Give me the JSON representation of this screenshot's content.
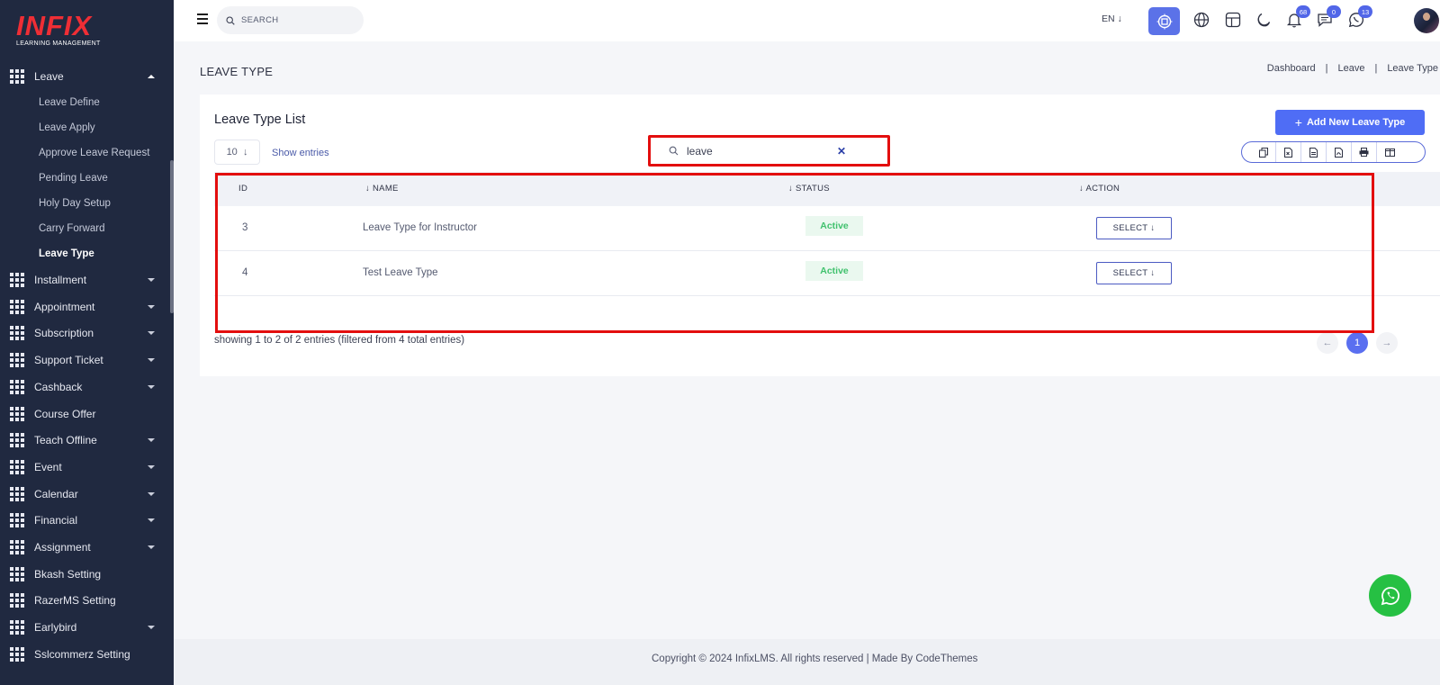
{
  "brand": {
    "name": "INFIX",
    "tagline": "LEARNING MANAGEMENT"
  },
  "sidebar": {
    "parent": {
      "label": "Leave",
      "icon": "grid-icon"
    },
    "subitems": [
      "Leave Define",
      "Leave Apply",
      "Approve Leave Request",
      "Pending Leave",
      "Holy Day Setup",
      "Carry Forward",
      "Leave Type"
    ],
    "active_subitem": "Leave Type",
    "items": [
      {
        "label": "Installment",
        "has_caret": true
      },
      {
        "label": "Appointment",
        "has_caret": true
      },
      {
        "label": "Subscription",
        "has_caret": true
      },
      {
        "label": "Support Ticket",
        "has_caret": true
      },
      {
        "label": "Cashback",
        "has_caret": true
      },
      {
        "label": "Course Offer",
        "has_caret": false
      },
      {
        "label": "Teach Offline",
        "has_caret": true
      },
      {
        "label": "Event",
        "has_caret": true
      },
      {
        "label": "Calendar",
        "has_caret": true
      },
      {
        "label": "Financial",
        "has_caret": true
      },
      {
        "label": "Assignment",
        "has_caret": true
      },
      {
        "label": "Bkash Setting",
        "has_caret": false
      },
      {
        "label": "RazerMS Setting",
        "has_caret": false
      },
      {
        "label": "Earlybird",
        "has_caret": true
      },
      {
        "label": "Sslcommerz Setting",
        "has_caret": false
      }
    ]
  },
  "header": {
    "search_placeholder": "SEARCH",
    "language": "EN",
    "badges": {
      "notifications": "68",
      "messages": "0",
      "whatsapp": "13"
    }
  },
  "page": {
    "title": "LEAVE TYPE",
    "breadcrumb": [
      "Dashboard",
      "Leave",
      "Leave Type"
    ]
  },
  "card": {
    "title": "Leave Type List",
    "add_button": "Add New Leave Type",
    "entries_value": "10",
    "show_entries": "Show entries",
    "search_value": "leave",
    "export_buttons": [
      "copy-icon",
      "excel-icon",
      "csv-icon",
      "pdf-icon",
      "print-icon",
      "columns-icon"
    ]
  },
  "table": {
    "headers": {
      "id": "ID",
      "name": "NAME",
      "status": "STATUS",
      "action": "ACTION"
    },
    "rows": [
      {
        "id": "3",
        "name": "Leave Type for Instructor",
        "status": "Active",
        "action": "SELECT"
      },
      {
        "id": "4",
        "name": "Test Leave Type",
        "status": "Active",
        "action": "SELECT"
      }
    ],
    "info": "showing 1 to 2 of 2 entries (filtered from 4 total entries)",
    "current_page": "1"
  },
  "footer": {
    "text": "Copyright © 2024 InfixLMS. All rights reserved | Made By CodeThemes"
  },
  "colors": {
    "sidebar": "#202940",
    "accent": "#4f6df5",
    "highlight": "#e30e0e",
    "status_active": "#40c16d",
    "whatsapp": "#26c043"
  }
}
